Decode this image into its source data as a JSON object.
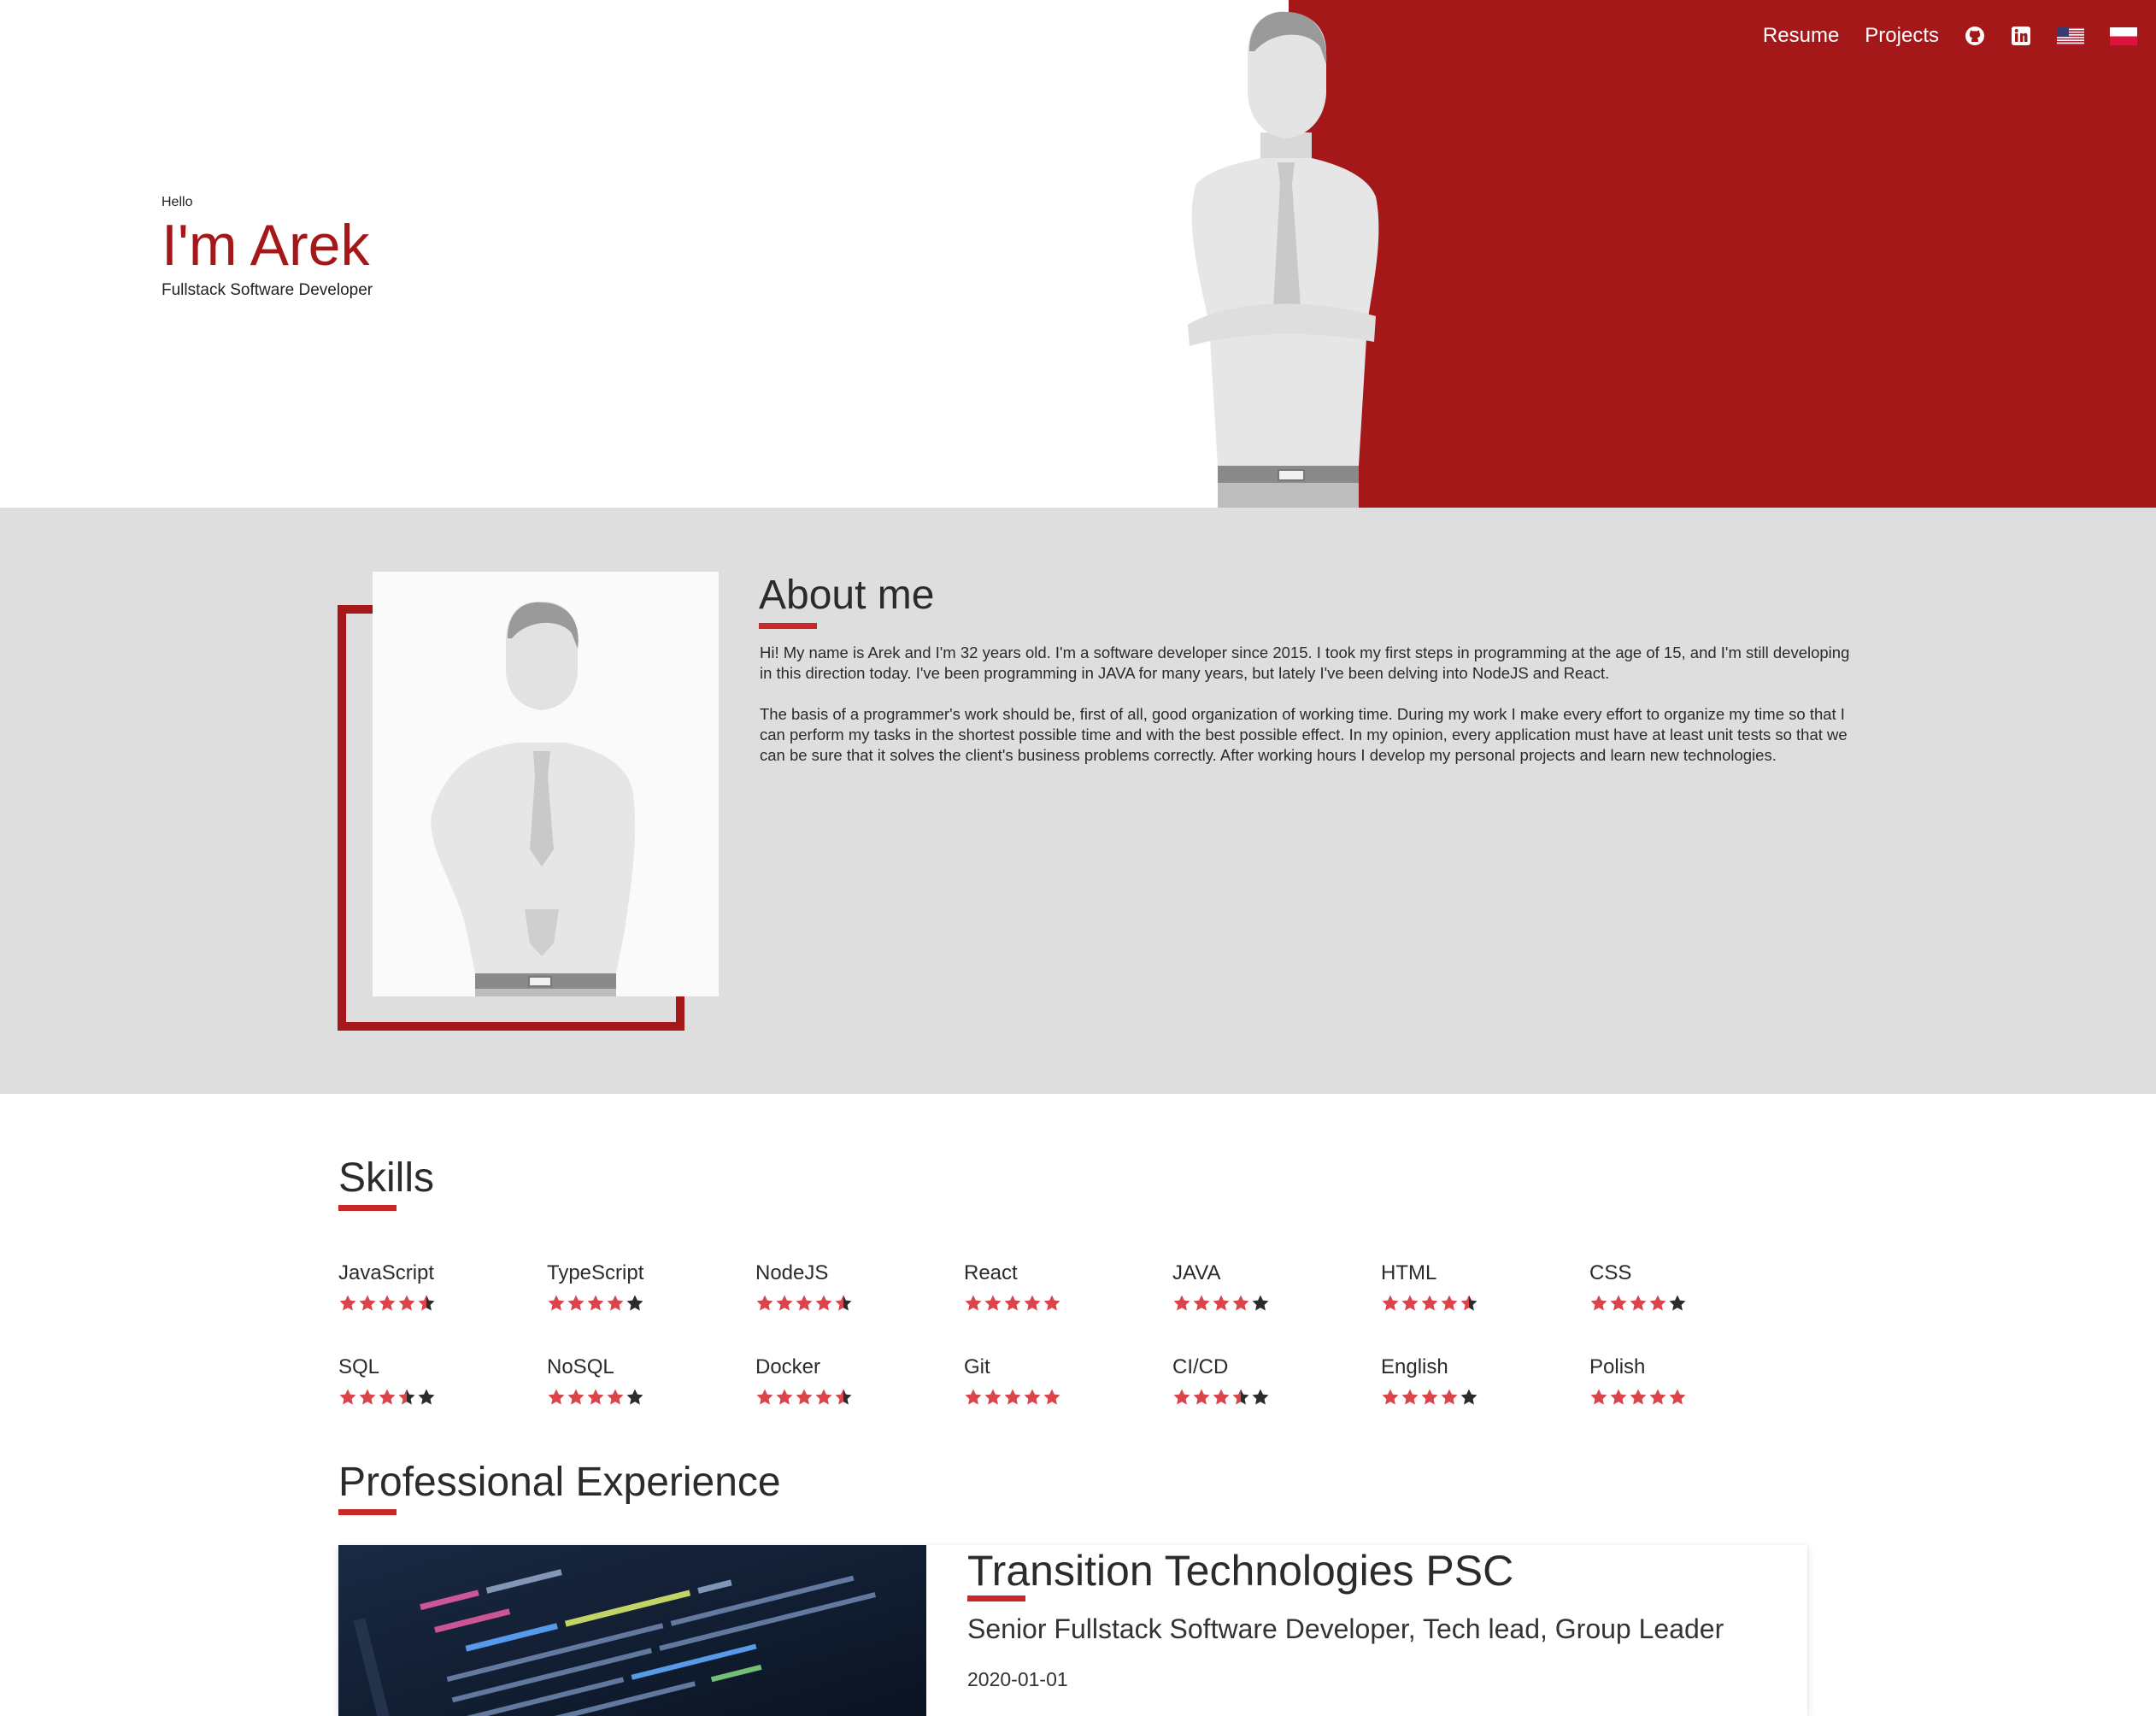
{
  "nav": {
    "links": [
      "Resume",
      "Projects"
    ],
    "icons": [
      "github-icon",
      "linkedin-icon"
    ],
    "languages": [
      "en-flag",
      "pl-flag"
    ]
  },
  "hero": {
    "greeting": "Hello",
    "name": "I'm Arek",
    "role": "Fullstack Software Developer"
  },
  "about": {
    "title": "About me",
    "paragraphs": [
      "Hi! My name is Arek and I'm 32 years old. I'm a software developer since 2015. I took my first steps in programming at the age of 15, and I'm still developing in this direction today. I've been programming in JAVA for many years, but lately I've been delving into NodeJS and React.",
      "The basis of a programmer's work should be, first of all, good organization of working time. During my work I make every effort to organize my time so that I can perform my tasks in the shortest possible time and with the best possible effect. In my opinion, every application must have at least unit tests so that we can be sure that it solves the client's business problems correctly. After working hours I develop my personal projects and learn new technologies."
    ]
  },
  "skills": {
    "title": "Skills",
    "items": [
      {
        "name": "JavaScript",
        "rating": 4.5
      },
      {
        "name": "TypeScript",
        "rating": 4
      },
      {
        "name": "NodeJS",
        "rating": 4.5
      },
      {
        "name": "React",
        "rating": 5
      },
      {
        "name": "JAVA",
        "rating": 4
      },
      {
        "name": "HTML",
        "rating": 4.5
      },
      {
        "name": "CSS",
        "rating": 4
      },
      {
        "name": "SQL",
        "rating": 3.5
      },
      {
        "name": "NoSQL",
        "rating": 4
      },
      {
        "name": "Docker",
        "rating": 4.5
      },
      {
        "name": "Git",
        "rating": 5
      },
      {
        "name": "CI/CD",
        "rating": 3.5
      },
      {
        "name": "English",
        "rating": 4
      },
      {
        "name": "Polish",
        "rating": 5
      }
    ]
  },
  "experience": {
    "title": "Professional Experience",
    "items": [
      {
        "company": "Transition Technologies PSC",
        "role": "Senior Fullstack Software Developer, Tech lead, Group Leader",
        "date": "2020-01-01"
      }
    ]
  },
  "colors": {
    "accent": "#a5181a",
    "underline": "#c8282a",
    "star_filled": "#d9454a",
    "star_empty": "#2b2b2b",
    "about_bg": "#dedede"
  }
}
